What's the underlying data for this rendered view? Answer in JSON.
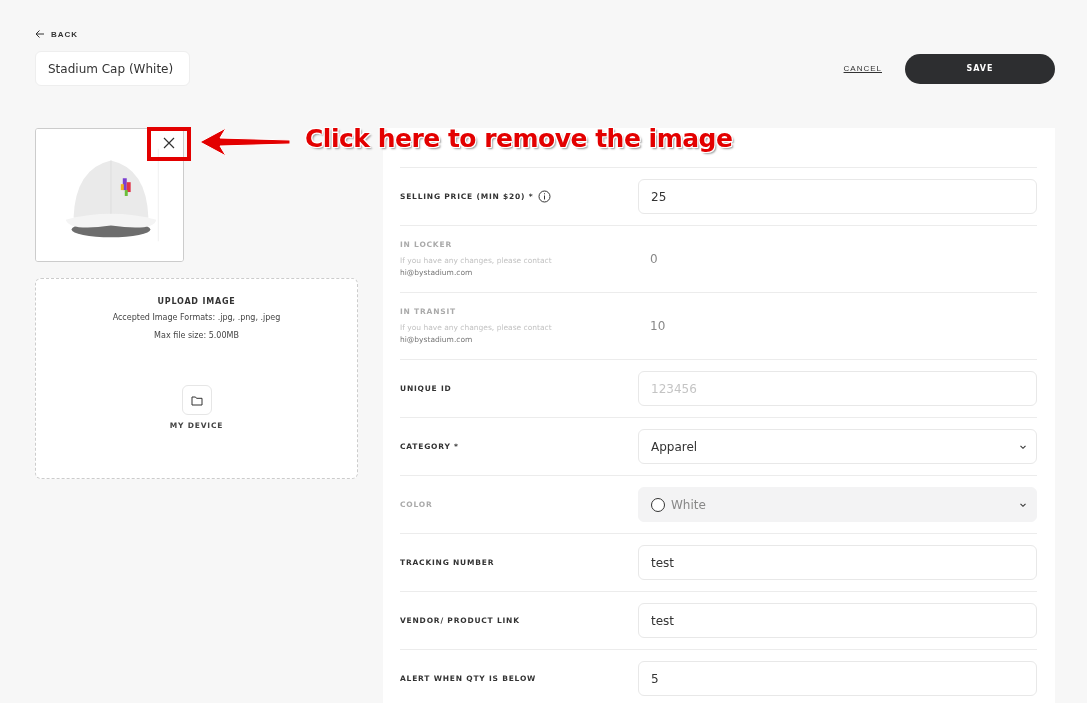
{
  "back_link": "BACK",
  "product_name": {
    "value": "Stadium Cap (White)"
  },
  "actions": {
    "cancel": "CANCEL",
    "save": "SAVE"
  },
  "upload": {
    "title": "UPLOAD IMAGE",
    "formats": "Accepted Image Formats: .jpg, .png, .jpeg",
    "max_size": "Max file size: 5.00MB",
    "source": "MY DEVICE"
  },
  "fields": [
    {
      "kind": "input",
      "label": "SELLING PRICE (MIN $20) *",
      "info": true,
      "value": "25"
    },
    {
      "kind": "readonly",
      "label": "IN LOCKER",
      "hint": "If you have any changes, please contact",
      "email": "hi@bystadium.com",
      "value": "0"
    },
    {
      "kind": "readonly",
      "label": "IN TRANSIT",
      "hint": "If you have any changes, please contact",
      "email": "hi@bystadium.com",
      "value": "10"
    },
    {
      "kind": "input",
      "label": "UNIQUE ID",
      "placeholder": "123456"
    },
    {
      "kind": "select",
      "label": "CATEGORY *",
      "disabled": false,
      "value": "Apparel"
    },
    {
      "kind": "color",
      "label": "COLOR",
      "disabled": true,
      "value": "White",
      "color": "#ffffff"
    },
    {
      "kind": "input",
      "label": "TRACKING NUMBER",
      "value": "test"
    },
    {
      "kind": "input",
      "label": "VENDOR/ PRODUCT LINK",
      "value": "test"
    },
    {
      "kind": "input",
      "label": "ALERT WHEN QTY IS BELOW",
      "value": "5"
    }
  ],
  "annotation": {
    "text": "Click here to remove the image"
  }
}
